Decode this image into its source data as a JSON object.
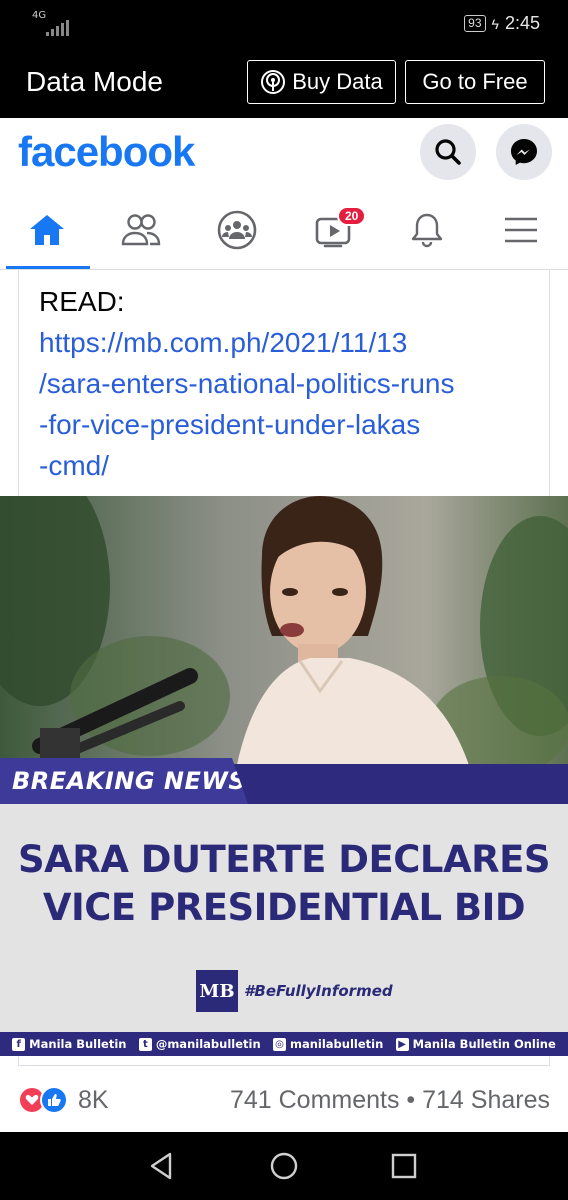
{
  "status_bar": {
    "network": "4G",
    "battery": "93",
    "time": "2:45"
  },
  "data_bar": {
    "title": "Data Mode",
    "buy_label": "Buy Data",
    "free_label": "Go to Free"
  },
  "header": {
    "logo": "facebook"
  },
  "nav": {
    "video_badge": "20"
  },
  "post": {
    "read_label": "READ:",
    "link_lines": [
      "https://mb.com.ph/2021/11/13",
      "/sara-enters-national-politics-runs",
      "-for-vice-president-under-lakas",
      "-cmd/"
    ],
    "image": {
      "breaking": "BREAKING NEWS",
      "headline_1": "SARA DUTERTE DECLARES",
      "headline_2": "VICE PRESIDENTIAL BID",
      "logo_text": "MB",
      "hashtag": "#BeFullyInformed",
      "social": [
        {
          "icon": "facebook-icon",
          "glyph": "f",
          "text": "Manila Bulletin"
        },
        {
          "icon": "twitter-icon",
          "glyph": "t",
          "text": "@manilabulletin"
        },
        {
          "icon": "instagram-icon",
          "glyph": "◎",
          "text": "manilabulletin"
        },
        {
          "icon": "youtube-icon",
          "glyph": "▶",
          "text": "Manila Bulletin Online"
        }
      ]
    },
    "reactions_count": "8K",
    "comments_shares": "741 Comments • 714 Shares"
  },
  "colors": {
    "fb_blue": "#1877f2",
    "link_blue": "#2a5ed8",
    "mb_navy": "#2b2a78",
    "badge_red": "#e41e3f"
  }
}
